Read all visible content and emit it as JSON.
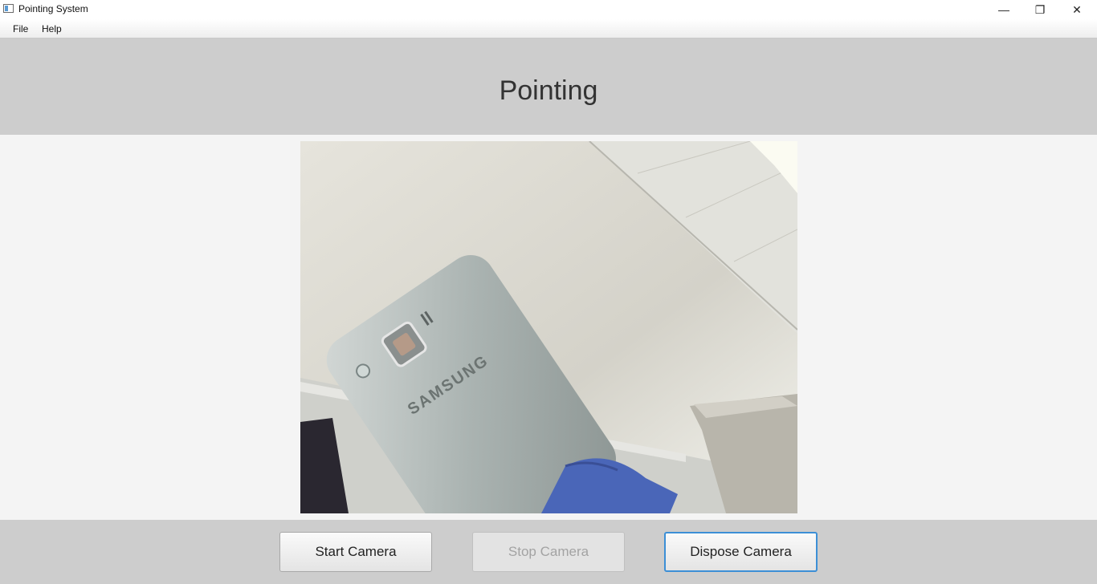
{
  "window": {
    "title": "Pointing System",
    "minimize_symbol": "—",
    "maximize_symbol": "❐",
    "close_symbol": "✕"
  },
  "menu": {
    "items": [
      {
        "label": "File"
      },
      {
        "label": "Help"
      }
    ]
  },
  "header": {
    "title": "Pointing"
  },
  "camera": {
    "feed": "webcam-image"
  },
  "buttons": {
    "start": {
      "label": "Start Camera",
      "enabled": true
    },
    "stop": {
      "label": "Stop Camera",
      "enabled": false
    },
    "dispose": {
      "label": "Dispose Camera",
      "enabled": true,
      "focused": true
    }
  },
  "colors": {
    "header_bg": "#cdcdcd",
    "focus_ring": "#3c8fd6"
  }
}
